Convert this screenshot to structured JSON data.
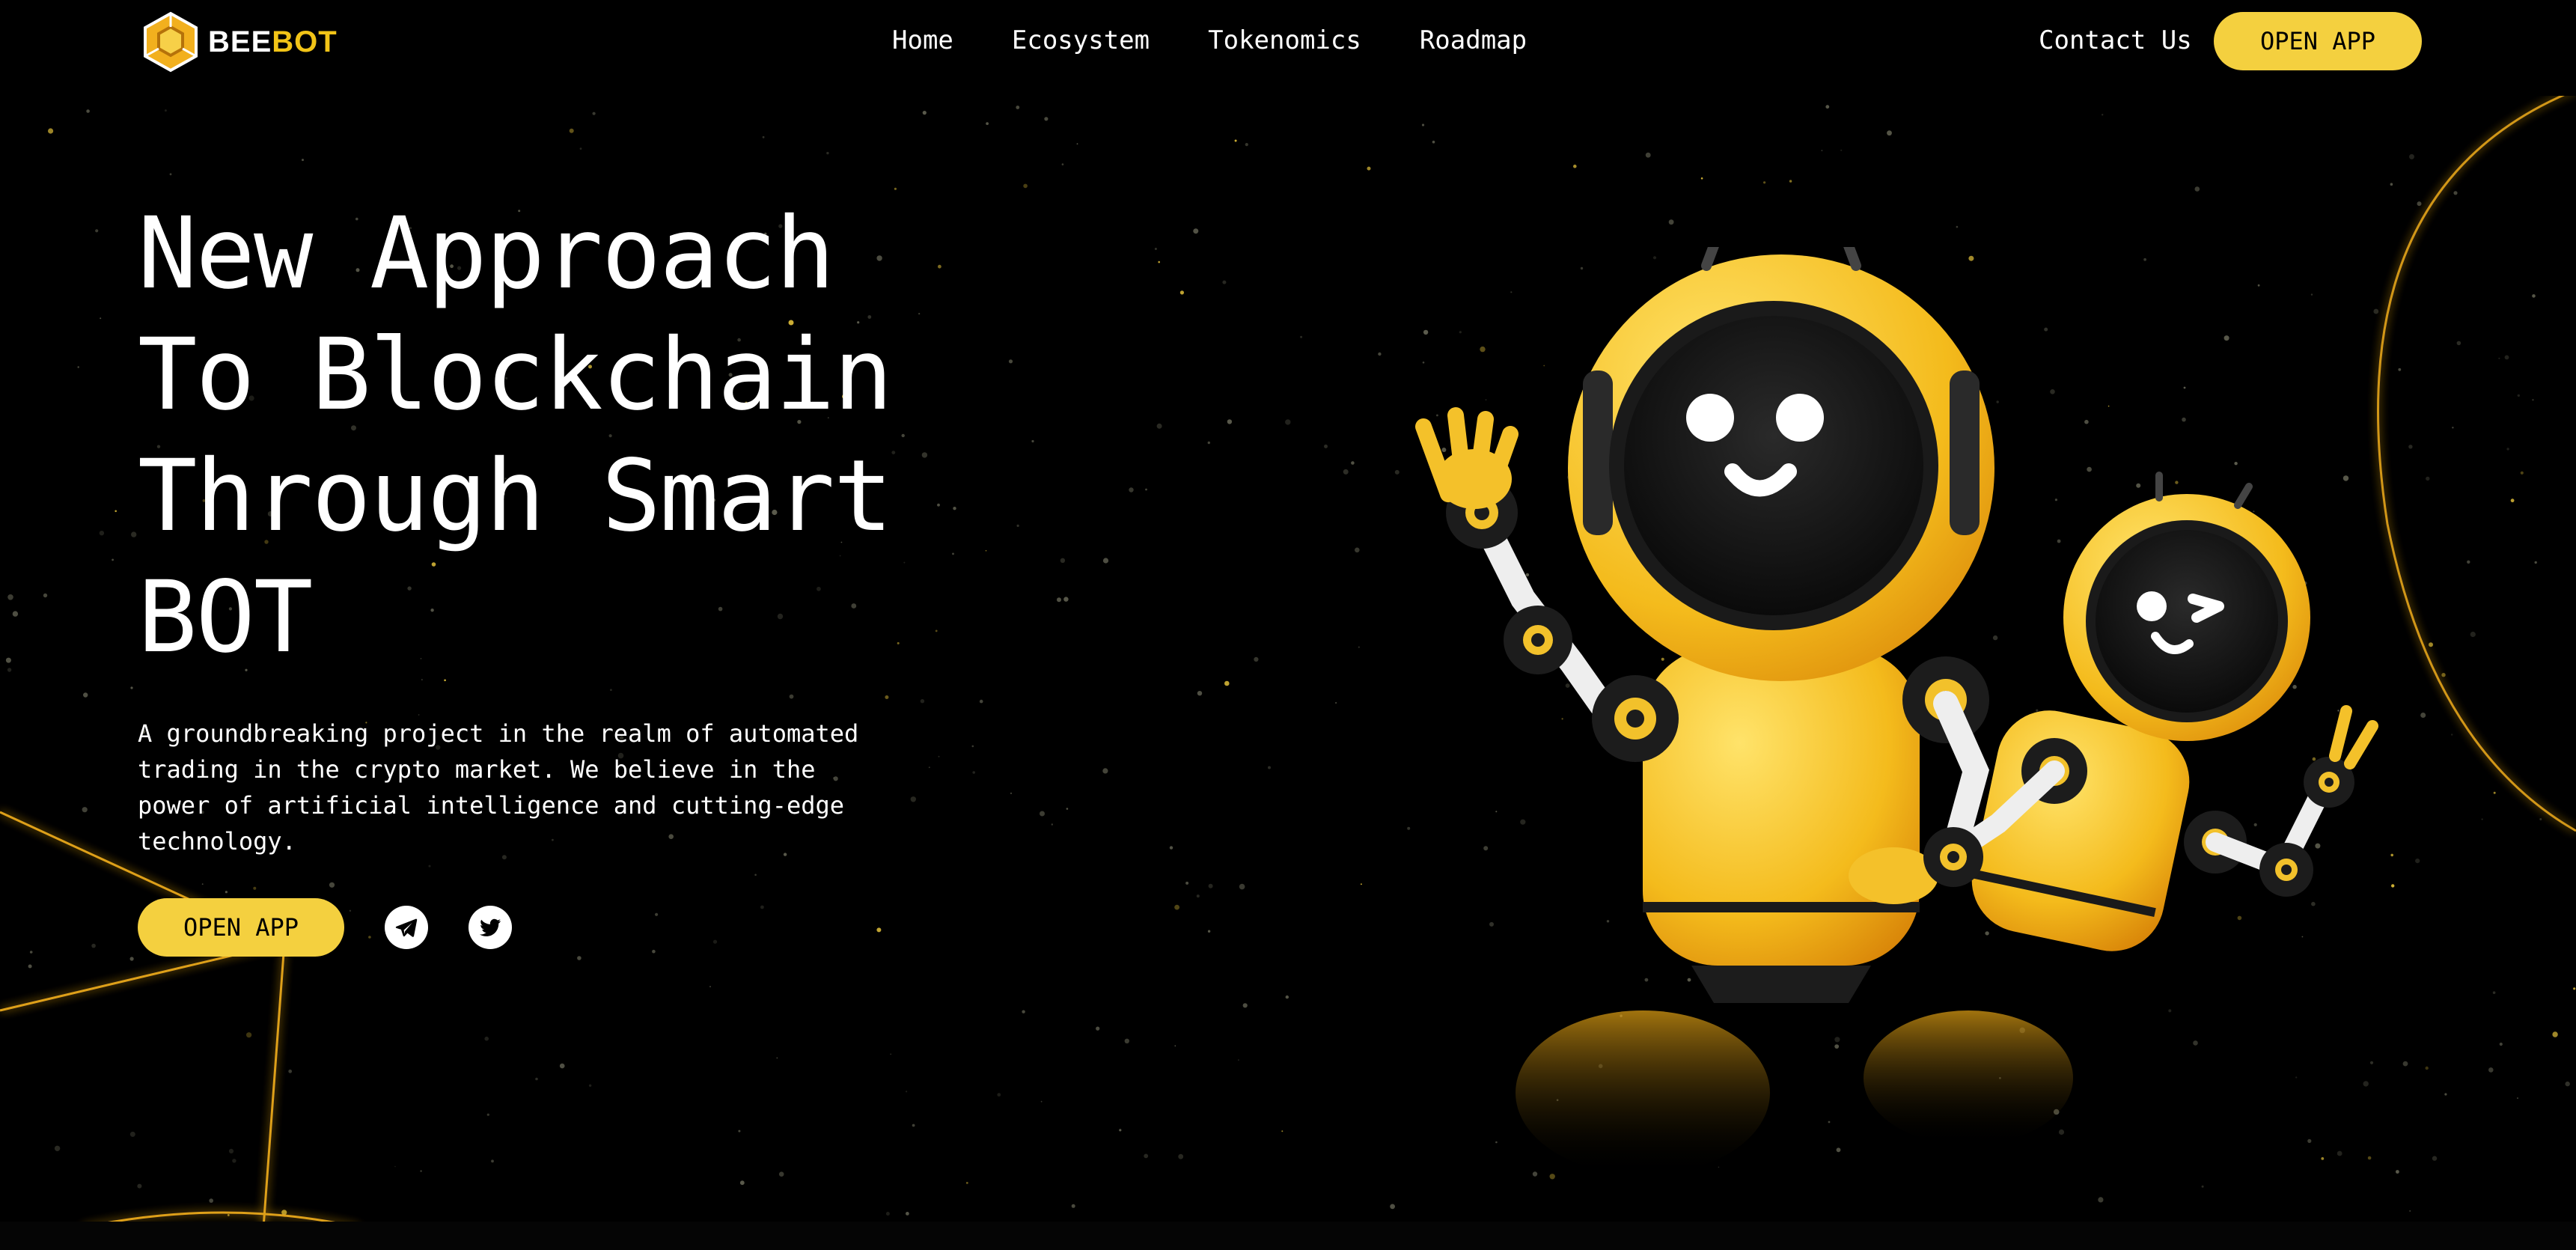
{
  "brand": {
    "name_part1": "BEE",
    "name_part2": "BOT",
    "accent_color": "#f4d03f"
  },
  "nav": {
    "items": [
      {
        "label": "Home"
      },
      {
        "label": "Ecosystem"
      },
      {
        "label": "Tokenomics"
      },
      {
        "label": "Roadmap"
      }
    ],
    "contact_label": "Contact Us",
    "open_app_label": "OPEN APP"
  },
  "hero": {
    "title_lines": [
      "New Approach",
      "To Blockchain",
      "Through Smart",
      "BOT"
    ],
    "description": "A groundbreaking project in the realm of automated trading in the crypto market. We believe in the power of artificial intelligence and cutting-edge technology.",
    "cta_label": "OPEN APP",
    "social": [
      {
        "icon": "telegram-icon"
      },
      {
        "icon": "twitter-icon"
      }
    ],
    "illustration": "two-yellow-robots-waving"
  }
}
